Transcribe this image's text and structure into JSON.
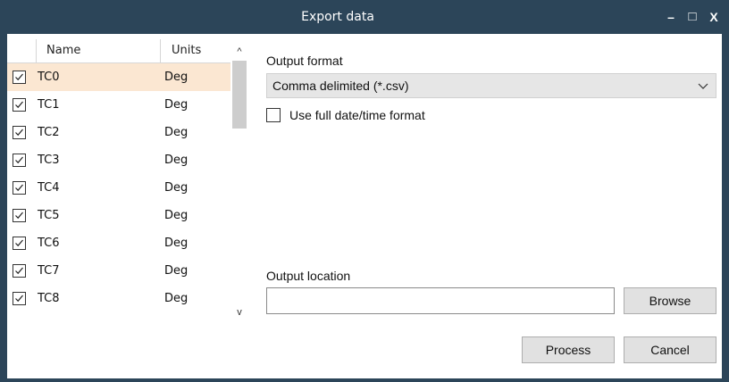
{
  "window": {
    "title": "Export data",
    "minimize_glyph": "–",
    "maximize_glyph": "□",
    "close_glyph": "X"
  },
  "list": {
    "columns": {
      "name": "Name",
      "units": "Units"
    },
    "rows": [
      {
        "name": "TC0",
        "units": "Deg",
        "checked": true,
        "selected": true
      },
      {
        "name": "TC1",
        "units": "Deg",
        "checked": true
      },
      {
        "name": "TC2",
        "units": "Deg",
        "checked": true
      },
      {
        "name": "TC3",
        "units": "Deg",
        "checked": true
      },
      {
        "name": "TC4",
        "units": "Deg",
        "checked": true
      },
      {
        "name": "TC5",
        "units": "Deg",
        "checked": true
      },
      {
        "name": "TC6",
        "units": "Deg",
        "checked": true
      },
      {
        "name": "TC7",
        "units": "Deg",
        "checked": true
      },
      {
        "name": "TC8",
        "units": "Deg",
        "checked": true
      }
    ],
    "scroll_up_glyph": "^",
    "scroll_down_glyph": "v"
  },
  "output_format": {
    "label": "Output format",
    "selected": "Comma delimited (*.csv)"
  },
  "full_datetime": {
    "label": "Use full date/time format",
    "checked": false
  },
  "output_location": {
    "label": "Output location",
    "value": "",
    "browse_label": "Browse"
  },
  "actions": {
    "process_label": "Process",
    "cancel_label": "Cancel"
  },
  "colors": {
    "titlebar": "#2c4559",
    "selected_row": "#fbe7d2",
    "button": "#e1e1e1"
  }
}
